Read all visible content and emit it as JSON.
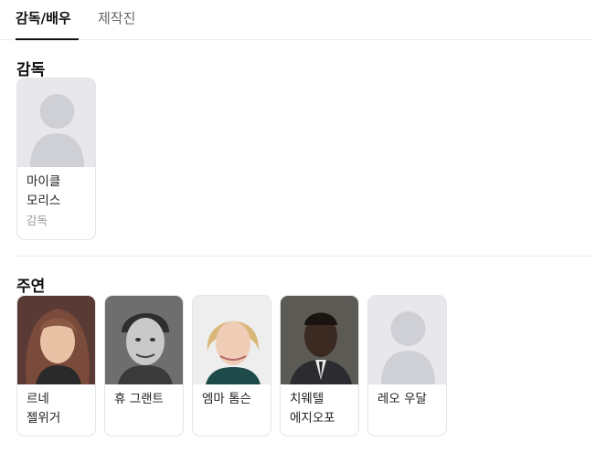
{
  "tabs": [
    {
      "label": "감독/배우",
      "active": true
    },
    {
      "label": "제작진",
      "active": false
    }
  ],
  "director_section": {
    "title": "감독",
    "people": [
      {
        "name": "마이클 모리스",
        "role": "감독",
        "photo": "placeholder-silhouette"
      }
    ]
  },
  "cast_section": {
    "title": "주연",
    "people": [
      {
        "name": "르네 젤위거",
        "photo": "portrait-woman-brown-hair"
      },
      {
        "name": "휴 그랜트",
        "photo": "portrait-man-grayscale"
      },
      {
        "name": "엠마 톰슨",
        "photo": "portrait-woman-blonde"
      },
      {
        "name": "치웨텔 에지오포",
        "photo": "portrait-man-suit"
      },
      {
        "name": "레오 우달",
        "photo": "placeholder-silhouette"
      }
    ]
  },
  "colors": {
    "placeholder_bg": "#e8e8ec",
    "silhouette": "#cfcfd6",
    "active_tab": "#111111",
    "inactive_tab": "#666666"
  }
}
